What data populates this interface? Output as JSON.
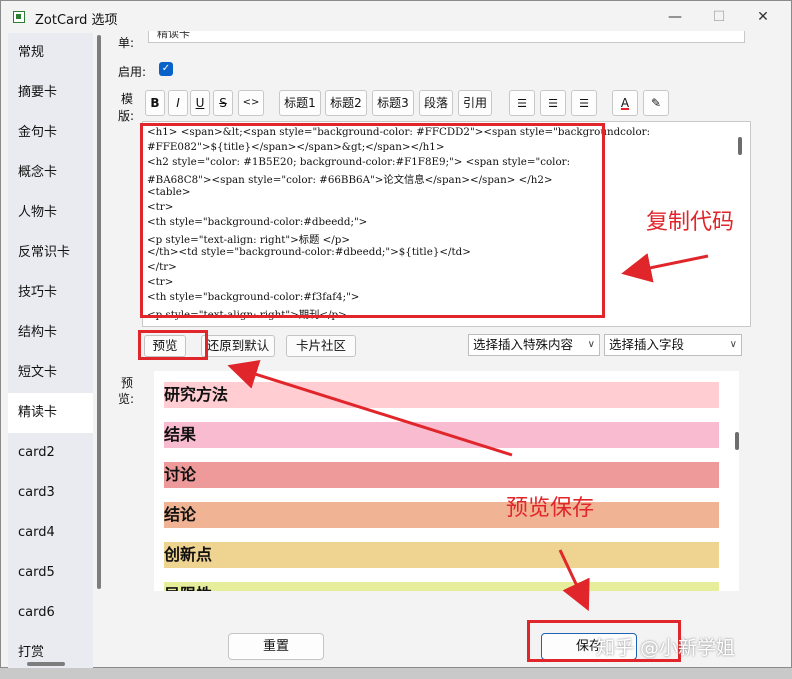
{
  "window": {
    "title": "ZotCard 选项",
    "minimize": "—",
    "maximize": "☐",
    "close": "✕"
  },
  "sidebar": {
    "items": [
      "常规",
      "摘要卡",
      "金句卡",
      "概念卡",
      "人物卡",
      "反常识卡",
      "技巧卡",
      "结构卡",
      "短文卡",
      "精读卡",
      "card2",
      "card3",
      "card4",
      "card5",
      "card6",
      "打赏"
    ],
    "active": "精读卡"
  },
  "form": {
    "top_label": "单:",
    "top_value": "精读卡",
    "enabled_label": "启用:",
    "enabled_checked": true,
    "template_label_1": "模",
    "template_label_2": "版:",
    "preview_label_1": "预",
    "preview_label_2": "览:"
  },
  "toolbar": {
    "bold": "B",
    "italic": "I",
    "underline": "U",
    "strike": "S",
    "code": "<>",
    "h1": "标题1",
    "h2": "标题2",
    "h3": "标题3",
    "paragraph": "段落",
    "quote": "引用",
    "font_color": "A",
    "highlight": "✎"
  },
  "editor": {
    "lines": [
      "<h1> <span>&lt;<span style=\"background-color: #FFCDD2\"><span style=\"backgroundcolor:",
      "#FFE082\">${title}</span></span>&gt;</span></h1>",
      "<h2 style=\"color: #1B5E20; background-color:#F1F8E9;\"> <span style=\"color:",
      "#BA68C8\"><span style=\"color: #66BB6A\">论文信息</span></span> </h2>",
      "<table>",
      "<tr>",
      "<th style=\"background-color:#dbeedd;\">",
      "<p style=\"text-align: right\">标题 </p>",
      "</th><td style=\"background-color:#dbeedd;\">${title}</td>",
      "</tr>",
      "<tr>",
      "<th style=\"background-color:#f3faf4;\">",
      "<p style=\"text-align: right\">期刊</p>"
    ]
  },
  "actions": {
    "preview": "预览",
    "reset_default": "还原到默认",
    "community": "卡片社区",
    "insert_special": "选择插入特殊内容",
    "insert_field": "选择插入字段"
  },
  "preview": {
    "rows": [
      {
        "text": "研究方法",
        "color": "#ffcdd2"
      },
      {
        "text": "结果",
        "color": "#f8bbd0"
      },
      {
        "text": "讨论",
        "color": "#ef9a9a"
      },
      {
        "text": "结论",
        "color": "#f0b393"
      },
      {
        "text": "创新点",
        "color": "#efd391"
      },
      {
        "text": "局限性",
        "color": "#e6ee9c"
      }
    ]
  },
  "footer": {
    "reset": "重置",
    "save": "保存"
  },
  "annotations": {
    "copy_code": "复制代码",
    "preview_save": "预览保存",
    "watermark": "知乎 @小新学姐",
    "accent": "#e0262b"
  }
}
